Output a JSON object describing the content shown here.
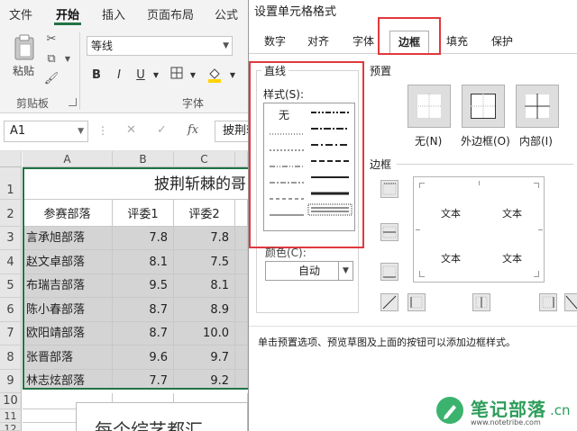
{
  "ribbon": {
    "tabs": [
      "文件",
      "开始",
      "插入",
      "页面布局",
      "公式"
    ],
    "active_tab": "开始",
    "clipboard": {
      "paste_label": "粘贴",
      "group_label": "剪贴板"
    },
    "font": {
      "name": "等线",
      "group_label": "字体",
      "bold": "B",
      "italic": "I",
      "underline": "U"
    }
  },
  "formula_bar": {
    "name_box": "A1",
    "cancel": "✕",
    "enter": "✓",
    "fx": "fx",
    "content": "披荆斩棘的哥哥"
  },
  "sheet": {
    "columns": [
      "A",
      "B",
      "C"
    ],
    "rows": [
      "1",
      "2",
      "3",
      "4",
      "5",
      "6",
      "7",
      "8",
      "9",
      "10",
      "11",
      "12"
    ],
    "title": "披荆斩棘的哥",
    "headers": [
      "参赛部落",
      "评委1",
      "评委2"
    ],
    "data": [
      [
        "言承旭部落",
        "7.8",
        "7.8"
      ],
      [
        "赵文卓部落",
        "8.1",
        "7.5"
      ],
      [
        "布瑞吉部落",
        "9.5",
        "8.1"
      ],
      [
        "陈小春部落",
        "8.7",
        "8.9"
      ],
      [
        "欧阳靖部落",
        "8.7",
        "10.0"
      ],
      [
        "张晋部落",
        "9.6",
        "9.7"
      ],
      [
        "林志炫部落",
        "7.7",
        "9.2"
      ]
    ],
    "bottom_text": "每个综艺都汇"
  },
  "dialog": {
    "title": "设置单元格格式",
    "tabs": [
      "数字",
      "对齐",
      "字体",
      "边框",
      "填充",
      "保护"
    ],
    "active_tab": "边框",
    "line_section": "直线",
    "style_label": "样式(S):",
    "style_none": "无",
    "color_label": "颜色(C):",
    "color_value": "自动",
    "presets_label": "预置",
    "presets": [
      "无(N)",
      "外边框(O)",
      "内部(I)"
    ],
    "border_label": "边框",
    "preview_text": [
      "文本",
      "文本",
      "文本",
      "文本"
    ],
    "hint": "单击预置选项、预览草图及上面的按钮可以添加边框样式。"
  },
  "watermark": {
    "title": "笔记部落",
    "suffix": ".cn",
    "url": "www.notetribe.com"
  },
  "colors": {
    "excel_green": "#217346",
    "highlight_red": "#e0393e",
    "selection_gray": "#d4d4d4"
  }
}
